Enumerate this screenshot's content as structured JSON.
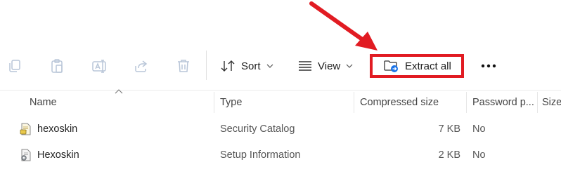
{
  "toolbar": {
    "icons": [
      "copy-icon",
      "paste-icon",
      "rename-icon",
      "share-icon",
      "delete-icon"
    ],
    "sort_label": "Sort",
    "view_label": "View",
    "extract_label": "Extract all",
    "more_label": "•••"
  },
  "columns": {
    "name": "Name",
    "type": "Type",
    "compressed_size": "Compressed size",
    "password": "Password p...",
    "size": "Size"
  },
  "rows": [
    {
      "name": "hexoskin",
      "type": "Security Catalog",
      "compressed_size": "7 KB",
      "password": "No",
      "icon": "security-catalog-icon"
    },
    {
      "name": "Hexoskin",
      "type": "Setup Information",
      "compressed_size": "2 KB",
      "password": "No",
      "icon": "setup-information-icon"
    }
  ],
  "colors": {
    "highlight": "#e11b22",
    "extract_icon_accent": "#1a73e8"
  }
}
